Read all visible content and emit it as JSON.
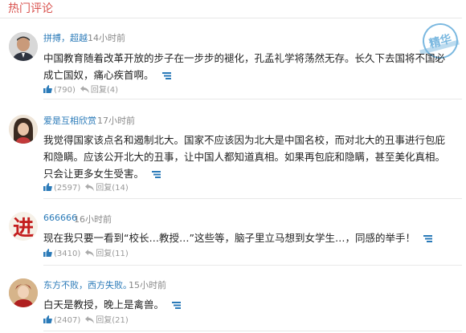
{
  "section_title": "热门评论",
  "stamp_label": "精华",
  "colors": {
    "accent": "#2a7ab8",
    "title": "#d9534f",
    "like": "#2a7ab8"
  },
  "comments": [
    {
      "author": "拼搏，超越",
      "time": "14小时前",
      "text": "中国教育随着改革开放的步子在一步步的褪化，孔孟礼学将荡然无存。长久下去国将不国必成亡国奴，痛心疾首啊。",
      "likes": "(790)",
      "reply": "回复(4)",
      "avatar": "man-portrait"
    },
    {
      "author": "爱是互相欣赏",
      "time": "17小时前",
      "text": "我觉得国家该点名和遏制北大。国家不应该因为北大是中国名校，而对北大的丑事进行包庇和隐瞒。应该公开北大的丑事，让中国人都知道真相。如果再包庇和隐瞒，甚至美化真相。只会让更多女生受害。",
      "likes": "(2597)",
      "reply": "回复(14)",
      "avatar": "woman-portrait"
    },
    {
      "author": "666666",
      "time": "16小时前",
      "text": "现在我只要一看到“校长…教授…”这些等，脑子里立马想到女学生…，同感的举手！",
      "likes": "(3410)",
      "reply": "回复(11)",
      "avatar": "calligraphy-jin",
      "avatar_text": "进"
    },
    {
      "author": "东方不败，西方失败。",
      "time": "15小时前",
      "text": "白天是教授，晚上是禽兽。",
      "likes": "(2407)",
      "reply": "回复(21)",
      "avatar": "costume-portrait"
    }
  ]
}
